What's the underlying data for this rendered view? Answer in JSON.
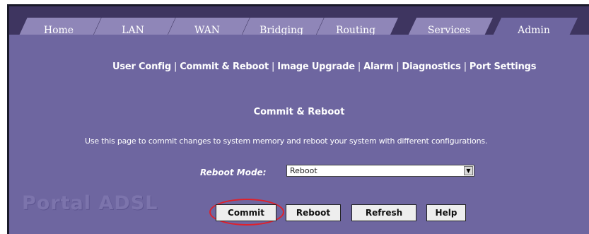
{
  "tabs": [
    {
      "label": "Home"
    },
    {
      "label": "LAN"
    },
    {
      "label": "WAN"
    },
    {
      "label": "Bridging"
    },
    {
      "label": "Routing"
    },
    {
      "label": "Services"
    },
    {
      "label": "Admin"
    }
  ],
  "active_tab": "Admin",
  "subnav": {
    "items": [
      "User Config",
      "Commit & Reboot",
      "Image Upgrade",
      "Alarm",
      "Diagnostics",
      "Port Settings"
    ],
    "separator": "|"
  },
  "page": {
    "title": "Commit & Reboot",
    "description": "Use this page to commit changes to system memory and reboot your system with different configurations.",
    "reboot_mode_label": "Reboot Mode:",
    "reboot_mode_value": "Reboot"
  },
  "buttons": {
    "commit": "Commit",
    "reboot": "Reboot",
    "refresh": "Refresh",
    "help": "Help"
  },
  "brand": "Portal ADSL",
  "colors": {
    "tab_bar": "#3e3560",
    "tab": "#8f86b8",
    "panel": "#6e66a0",
    "highlight": "#e0202a"
  }
}
